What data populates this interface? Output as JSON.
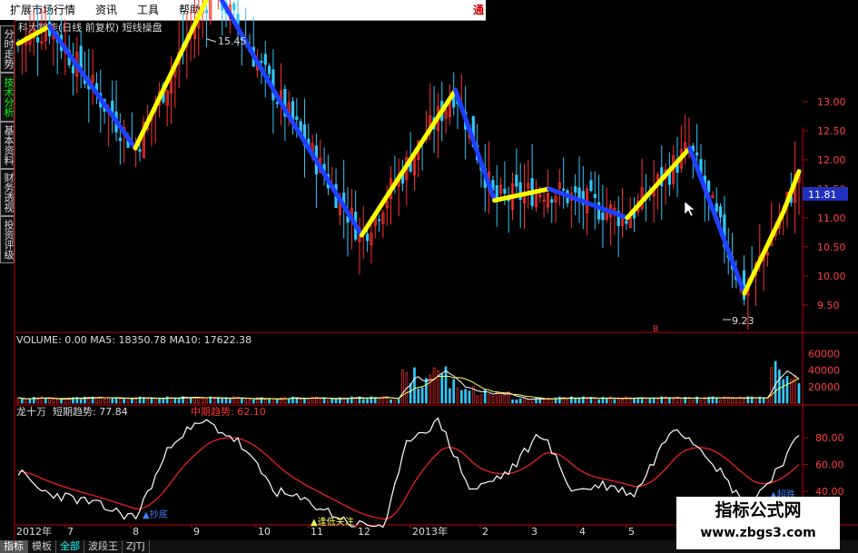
{
  "menu": {
    "items": [
      "扩展市场行情",
      "资讯",
      "工具",
      "帮助"
    ],
    "right_text": "通"
  },
  "sidebar": {
    "tabs": [
      "分时走势",
      "技术分析",
      "基本资料",
      "财务透视",
      "投资评级"
    ],
    "active": 1
  },
  "main": {
    "title": "科大智能(日线 前复权) 短线操盘",
    "high_label": "15.45",
    "low_label": "9.23",
    "marker_label": "B",
    "price_ticks": [
      "13.00",
      "12.50",
      "12.00",
      "11.50",
      "11.00",
      "10.50",
      "10.00",
      "9.50"
    ],
    "current_price": "11.81"
  },
  "volume": {
    "label": "VOLUME: 0.00  MA5: 18350.78  MA10: 17622.38",
    "ticks": [
      "60000",
      "40000",
      "20000"
    ]
  },
  "indicator": {
    "name": "龙十万",
    "short_label": "短期趋势: 77.84",
    "mid_label": "中期趋势: 62.10",
    "ticks": [
      "80.00",
      "60.00",
      "40.00"
    ],
    "buy_label": "▲抄底",
    "watch_label": "▲逢低关注",
    "right_label": "▲超跌"
  },
  "dates": {
    "year": "2012年",
    "months": [
      "7",
      "8",
      "9",
      "10",
      "11",
      "12",
      "2013年",
      "2",
      "3",
      "4",
      "5",
      "6"
    ]
  },
  "bottom_tabs": [
    "指标",
    "模板",
    "全部",
    "波段王",
    "ZJTJ"
  ],
  "watermark": {
    "line1": "指标公式网",
    "line2": "www.zbgs3.com"
  },
  "chart_data": {
    "type": "line",
    "title": "科大智能(日线 前复权) 短线操盘",
    "x": [
      "2012-07",
      "2012-08",
      "2012-09",
      "2012-10",
      "2012-11",
      "2012-12",
      "2013-01",
      "2013-02",
      "2013-03",
      "2013-04",
      "2013-05",
      "2013-06"
    ],
    "series": [
      {
        "name": "短线操盘",
        "values": [
          14.3,
          12.2,
          15.0,
          12.6,
          10.7,
          13.2,
          11.3,
          11.5,
          11.0,
          12.2,
          9.7,
          11.1
        ]
      }
    ],
    "ylim": [
      9.2,
      13.5
    ],
    "colors": {
      "up": "#ff3030",
      "down": "#30c8ff",
      "trend_up": "#ffff00",
      "trend_down": "#2040ff",
      "short": "#ffffff",
      "mid": "#ff2020",
      "price_box": "#2030c0"
    }
  }
}
